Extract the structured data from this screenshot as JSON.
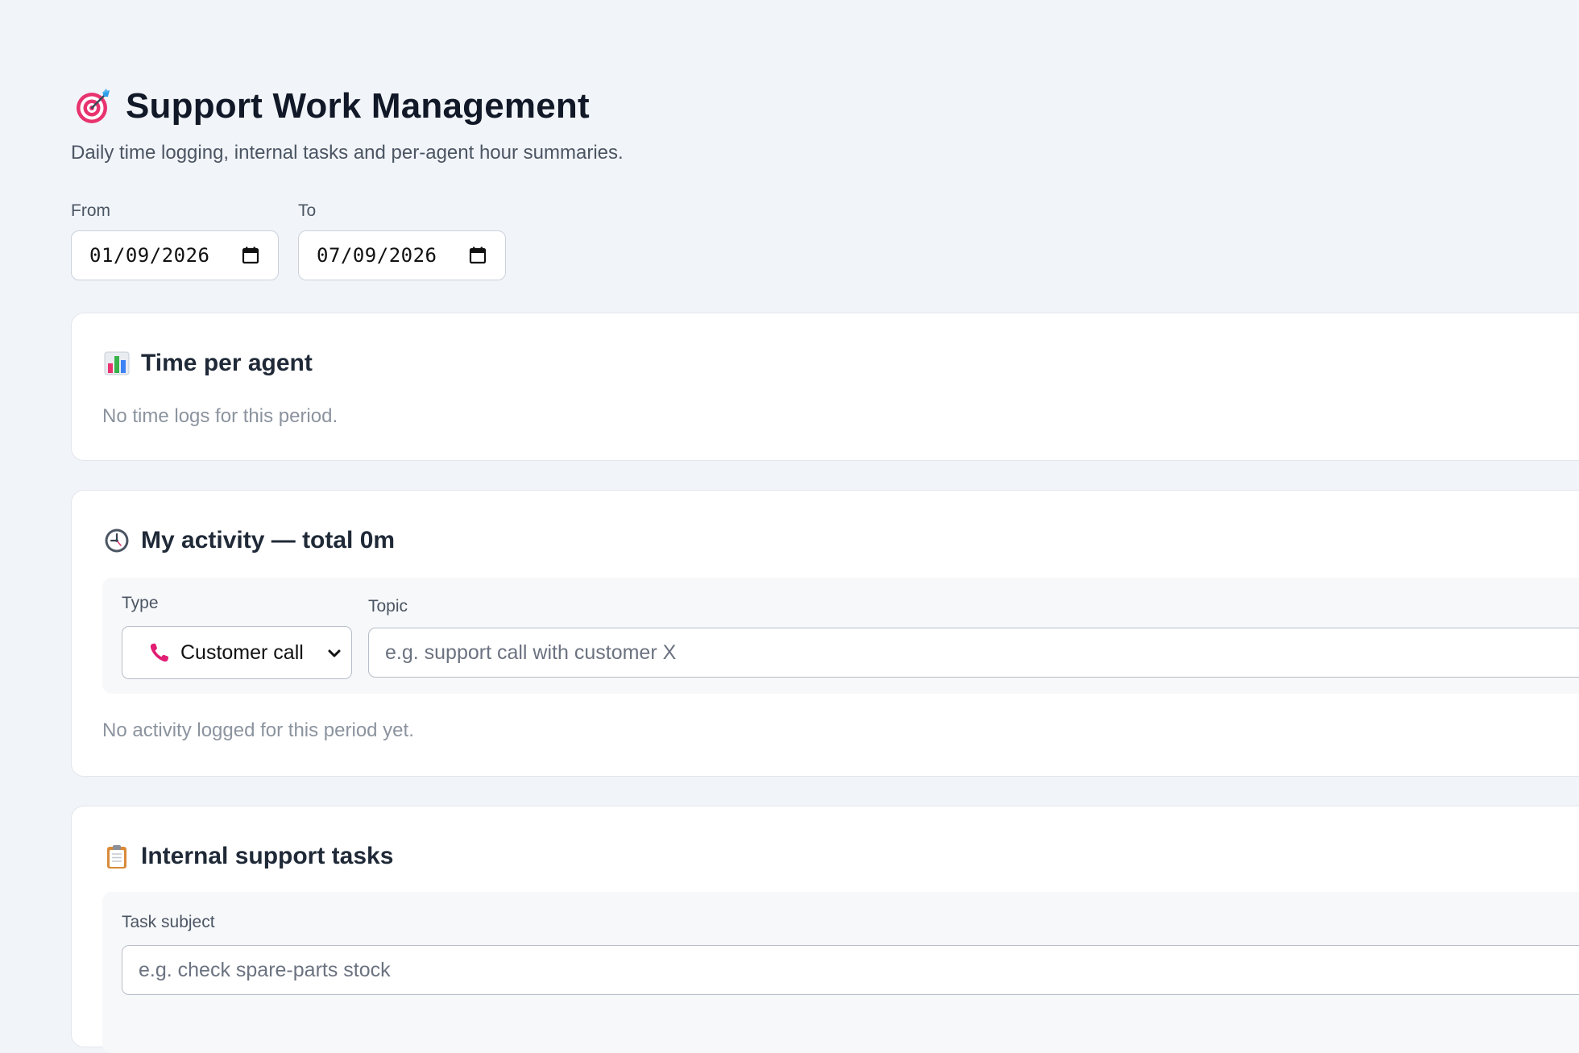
{
  "header": {
    "title": "Support Work Management",
    "subtitle": "Daily time logging, internal tasks and per-agent hour summaries.",
    "icon": "target-dart-icon"
  },
  "filters": {
    "from_label": "From",
    "from_value": "01/09/2026",
    "to_label": "To",
    "to_value": "07/09/2026"
  },
  "time_per_agent": {
    "icon": "bar-chart-icon",
    "title": "Time per agent",
    "empty_text": "No time logs for this period."
  },
  "my_activity": {
    "icon": "clock-icon",
    "title": "My activity — total 0m",
    "type_label": "Type",
    "type_value": "Customer call",
    "type_icon": "telephone-receiver-icon",
    "topic_label": "Topic",
    "topic_placeholder": "e.g. support call with customer X",
    "empty_text": "No activity logged for this period yet."
  },
  "internal_tasks": {
    "icon": "clipboard-icon",
    "title": "Internal support tasks",
    "subject_label": "Task subject",
    "subject_placeholder": "e.g. check spare-parts stock"
  },
  "colors": {
    "background": "#f1f4f8",
    "card": "#ffffff",
    "title_text": "#111827",
    "muted_text": "#8b939e",
    "accent_pink": "#e11d74"
  }
}
